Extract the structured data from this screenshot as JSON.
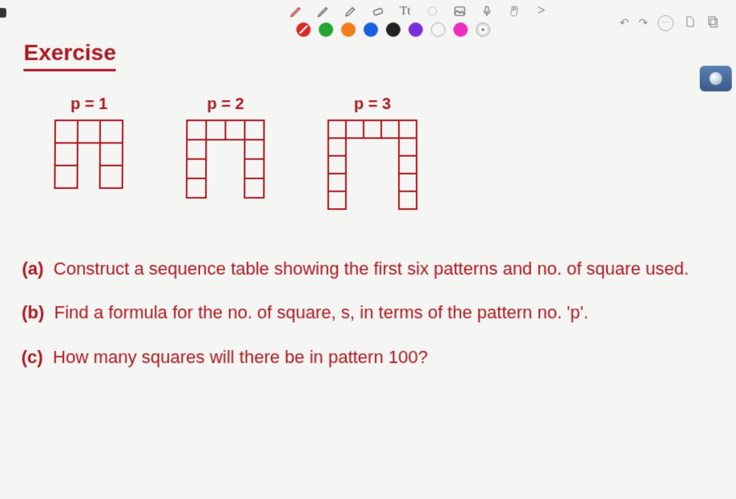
{
  "toolbar": {
    "tools": {
      "pen": "pen-icon",
      "pencil": "pencil-icon",
      "highlighter": "highlighter-icon",
      "eraser": "eraser-icon",
      "text": "Tt",
      "lasso": "lasso-icon",
      "image": "image-icon",
      "mic": "mic-icon",
      "hand": "hand-icon",
      "next": ">"
    },
    "colors": [
      "#d62a2a",
      "#22a52e",
      "#f07d1a",
      "#1a5fe0",
      "#222222",
      "#7a2fd6",
      "hollow",
      "#e82fbd",
      "cd"
    ],
    "right": {
      "undo": "↶",
      "redo": "↷",
      "more": "⋯",
      "page": "page-icon",
      "copy": "copy-icon"
    }
  },
  "exercise": {
    "title": "Exercise",
    "patterns": {
      "p1_label": "p = 1",
      "p2_label": "p = 2",
      "p3_label": "p = 3"
    },
    "questions": {
      "a_label": "(a)",
      "a_text": "Construct a sequence table showing the first six patterns and no. of square used.",
      "b_label": "(b)",
      "b_text": "Find a formula for the no. of square, s, in terms of the pattern no. 'p'.",
      "c_label": "(c)",
      "c_text": "How many squares will there be in pattern 100?"
    }
  }
}
